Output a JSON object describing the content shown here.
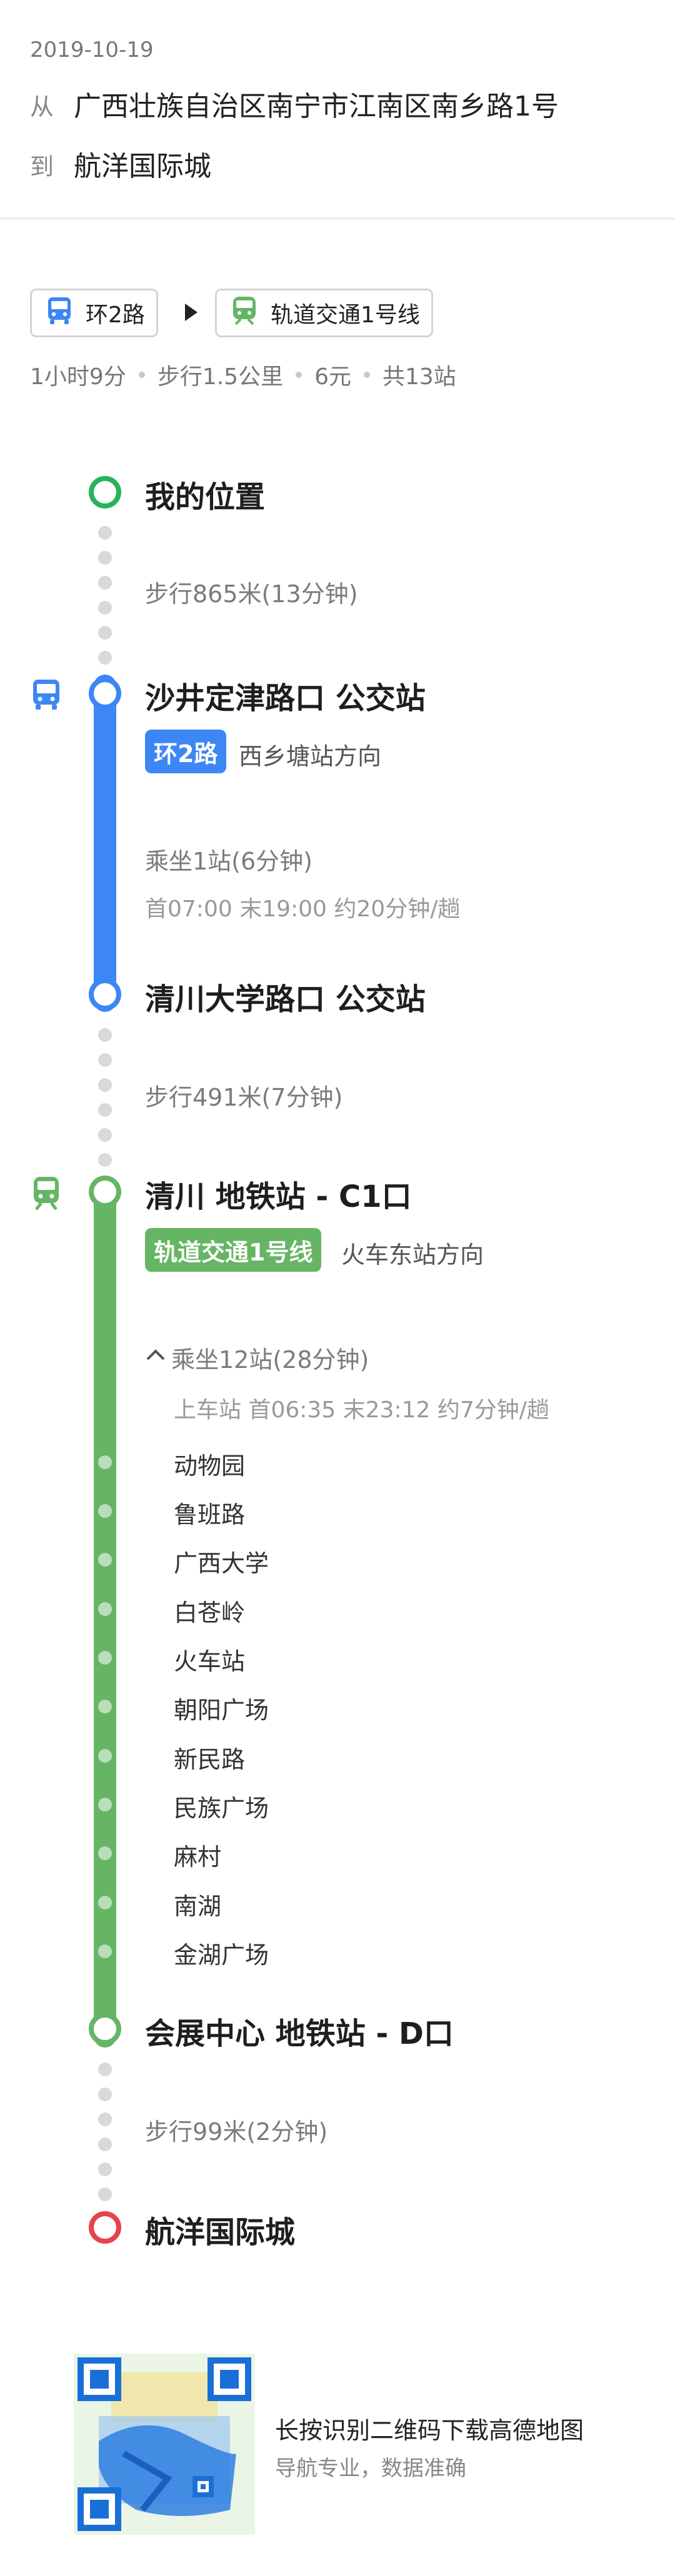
{
  "header": {
    "date": "2019-10-19",
    "from_label": "从",
    "from_text": "广西壮族自治区南宁市江南区南乡路1号",
    "to_label": "到",
    "to_text": "航洋国际城"
  },
  "route_chips": [
    {
      "label": "环2路",
      "icon": "bus-icon"
    },
    {
      "label": "轨道交通1号线",
      "icon": "metro-icon"
    }
  ],
  "summary": [
    "1小时9分",
    "步行1.5公里",
    "6元",
    "共13站"
  ],
  "colors": {
    "bus": "#3d86f5",
    "metro": "#65b565",
    "start": "#27b35a",
    "end": "#e8424a",
    "walk_dot": "#d9d9d9"
  },
  "steps": {
    "start": "我的位置",
    "walk1": "步行865米(13分钟)",
    "bus_board": "沙井定津路口 公交站",
    "bus_line": "环2路",
    "bus_direction": "西乡塘站方向",
    "bus_ride": "乘坐1站(6分钟)",
    "bus_schedule": "首07:00  末19:00  约20分钟/趟",
    "bus_alight": "清川大学路口 公交站",
    "walk2": "步行491米(7分钟)",
    "metro_board": "清川 地铁站 - C1口",
    "metro_line": "轨道交通1号线",
    "metro_direction": "火车东站方向",
    "metro_ride": "乘坐12站(28分钟)",
    "metro_schedule": "上车站 首06:35  末23:12  约7分钟/趟",
    "metro_stops": [
      "动物园",
      "鲁班路",
      "广西大学",
      "白苍岭",
      "火车站",
      "朝阳广场",
      "新民路",
      "民族广场",
      "麻村",
      "南湖",
      "金湖广场"
    ],
    "metro_alight": "会展中心 地铁站 - D口",
    "walk3": "步行99米(2分钟)",
    "end": "航洋国际城"
  },
  "promo": {
    "title": "长按识别二维码下载高德地图",
    "subtitle": "导航专业，数据准确"
  }
}
